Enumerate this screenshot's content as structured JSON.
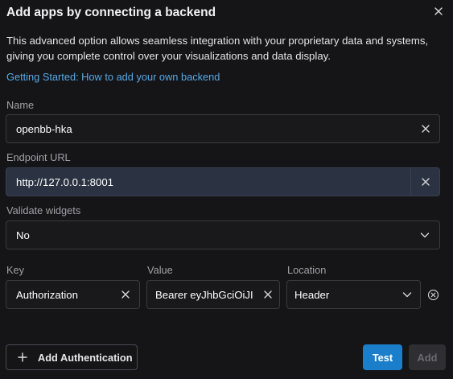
{
  "dialog": {
    "title": "Add apps by connecting a backend",
    "description": "This advanced option allows seamless integration with your proprietary data and systems, giving you complete control over your visualizations and data display.",
    "link_text": "Getting Started: How to add your own backend"
  },
  "form": {
    "name": {
      "label": "Name",
      "value": "openbb-hka"
    },
    "endpoint": {
      "label": "Endpoint URL",
      "value": "http://127.0.0.1:8001"
    },
    "validate": {
      "label": "Validate widgets",
      "value": "No"
    },
    "auth": {
      "key_label": "Key",
      "value_label": "Value",
      "location_label": "Location",
      "key": "Authorization",
      "value": "Bearer eyJhbGciOiJI",
      "location": "Header"
    }
  },
  "actions": {
    "add_auth_label": "Add Authentication",
    "test_label": "Test",
    "add_label": "Add"
  },
  "colors": {
    "background": "#151518",
    "accent": "#1a7ecb",
    "link": "#56a9e6",
    "active_field": "#2b3241"
  }
}
